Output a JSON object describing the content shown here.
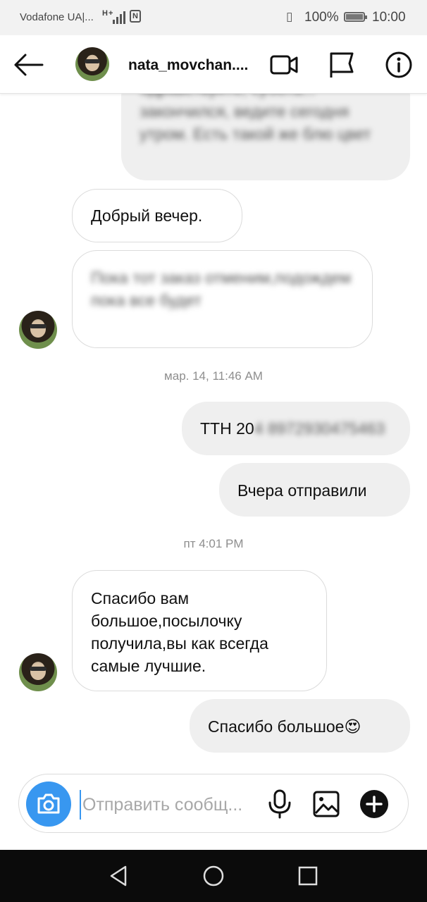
{
  "status_bar": {
    "carrier": "Vodafone UA|...",
    "network": "H+",
    "battery": "100%",
    "time": "10:00"
  },
  "header": {
    "username": "nata_movchan...."
  },
  "messages": [
    {
      "text": "Здравствуйте, субота... закончился, ведите сегодня утром. Есть такой же блю цвет",
      "blurred": true
    },
    {
      "text": "Добрый вечер."
    },
    {
      "text": "Пока тот заказ отменим,подождем пока все будет",
      "blurred": true
    },
    {
      "text": "ТТН 20"
    },
    {
      "text": "4 8972930475463",
      "blurred": true
    },
    {
      "text": "Вчера отправили"
    },
    {
      "text": "Спасибо вам большое,посылочку получила,вы как всегда самые лучшие."
    },
    {
      "text": "Спасибо большое"
    }
  ],
  "timestamps": [
    "мар. 14, 11:46 AM",
    "пт 4:01 PM"
  ],
  "emoji": "😍",
  "composer": {
    "placeholder": "Отправить сообщ..."
  },
  "colors": {
    "accent": "#3897f0",
    "outgoing_bubble": "#efefef",
    "incoming_border": "#dbdbdb"
  },
  "icons": [
    "back-arrow-icon",
    "video-call-icon",
    "flag-icon",
    "info-icon",
    "camera-icon",
    "microphone-icon",
    "gallery-icon",
    "plus-icon"
  ]
}
